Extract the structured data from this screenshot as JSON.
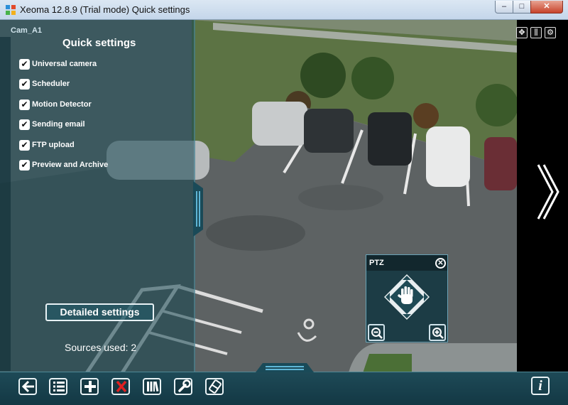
{
  "window": {
    "title": "Xeoma 12.8.9 (Trial mode) Quick settings",
    "controls": {
      "minimize": "–",
      "maximize": "□",
      "close": "✕"
    }
  },
  "camera": {
    "name": "Cam_A1",
    "toolbar_icons": [
      "fullscreen-icon",
      "archive-icon",
      "settings-icon"
    ]
  },
  "quick_settings": {
    "title": "Quick settings",
    "items": [
      {
        "label": "Universal camera",
        "checked": true
      },
      {
        "label": "Scheduler",
        "checked": true
      },
      {
        "label": "Motion Detector",
        "checked": true
      },
      {
        "label": "Sending email",
        "checked": true
      },
      {
        "label": "FTP upload",
        "checked": true
      },
      {
        "label": "Preview and Archive",
        "checked": true
      }
    ],
    "detailed_button": "Detailed settings",
    "sources_used": "Sources used: 2"
  },
  "ptz": {
    "title": "PTZ",
    "close": "✕",
    "icons": [
      "hand-icon",
      "zoom-out-icon",
      "zoom-in-icon"
    ]
  },
  "bottom_toolbar": {
    "buttons": [
      "back-icon",
      "list-icon",
      "add-icon",
      "delete-icon",
      "archive-icon",
      "wrench-icon",
      "eraser-icon"
    ],
    "info": "i"
  },
  "colors": {
    "panel": "#14464f",
    "accent": "#4fa8c9",
    "delete": "#e02020"
  }
}
